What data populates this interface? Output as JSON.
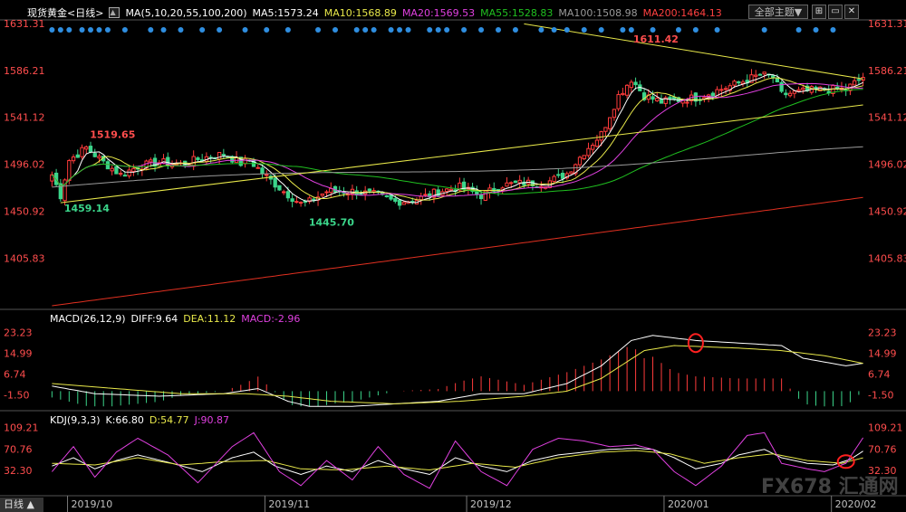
{
  "header": {
    "title": "现货黄金<日线>",
    "ma_label": "MA(5,10,20,55,100,200)",
    "ma5": "MA5:1573.24",
    "ma10": "MA10:1568.89",
    "ma20": "MA20:1569.53",
    "ma55": "MA55:1528.83",
    "ma100": "MA100:1508.98",
    "ma200": "MA200:1464.13",
    "theme_button": "全部主题▼"
  },
  "macd_header": {
    "label": "MACD(26,12,9)",
    "diff": "DIFF:9.64",
    "dea": "DEA:11.12",
    "macd": "MACD:-2.96"
  },
  "kdj_header": {
    "label": "KDJ(9,3,3)",
    "k": "K:66.80",
    "d": "D:54.77",
    "j": "J:90.87"
  },
  "period_tab": "日线 ▲",
  "watermark": "FX678 汇通网",
  "colors": {
    "up": "#ff3b3b",
    "down": "#3bd58a",
    "ma5": "#ffffff",
    "ma10": "#e8e84a",
    "ma20": "#e040e0",
    "ma55": "#20c020",
    "ma100": "#9a9a9a",
    "ma200": "#e03020",
    "trend": "#e8e84a",
    "axis": "#c0c0c0"
  },
  "chart_data": [
    {
      "type": "candlestick",
      "title": "现货黄金<日线>",
      "price_ticks": [
        "1631.31",
        "1586.21",
        "1541.12",
        "1496.02",
        "1450.92",
        "1405.83"
      ],
      "ylim": [
        1360,
        1631.31
      ],
      "x_labels": [
        "2019/10",
        "2019/11",
        "2019/12",
        "2020/01",
        "2020/02"
      ],
      "annotations": [
        {
          "text": "1519.65",
          "value": 1519.65,
          "bar": 8
        },
        {
          "text": "1459.14",
          "value": 1459.14,
          "bar": 2
        },
        {
          "text": "1445.70",
          "value": 1445.7,
          "bar": 59
        },
        {
          "text": "1611.42",
          "value": 1611.42,
          "bar": 135
        }
      ],
      "anchors": [
        [
          0,
          1486
        ],
        [
          2,
          1466
        ],
        [
          4,
          1500
        ],
        [
          8,
          1512
        ],
        [
          12,
          1498
        ],
        [
          16,
          1486
        ],
        [
          20,
          1494
        ],
        [
          25,
          1498
        ],
        [
          30,
          1496
        ],
        [
          35,
          1502
        ],
        [
          40,
          1506
        ],
        [
          44,
          1497
        ],
        [
          46,
          1500
        ],
        [
          50,
          1484
        ],
        [
          54,
          1470
        ],
        [
          58,
          1458
        ],
        [
          60,
          1460
        ],
        [
          64,
          1470
        ],
        [
          70,
          1470
        ],
        [
          75,
          1467
        ],
        [
          80,
          1460
        ],
        [
          85,
          1462
        ],
        [
          90,
          1470
        ],
        [
          95,
          1474
        ],
        [
          100,
          1466
        ],
        [
          105,
          1476
        ],
        [
          110,
          1478
        ],
        [
          115,
          1478
        ],
        [
          120,
          1487
        ],
        [
          124,
          1508
        ],
        [
          128,
          1525
        ],
        [
          132,
          1562
        ],
        [
          135,
          1578
        ],
        [
          138,
          1562
        ],
        [
          142,
          1556
        ],
        [
          146,
          1558
        ],
        [
          150,
          1560
        ],
        [
          155,
          1567
        ],
        [
          160,
          1574
        ],
        [
          165,
          1582
        ],
        [
          168,
          1580
        ],
        [
          170,
          1563
        ],
        [
          175,
          1566
        ],
        [
          180,
          1568
        ],
        [
          185,
          1568
        ],
        [
          189,
          1580
        ]
      ],
      "ma_end_values": {
        "MA5": 1573.24,
        "MA10": 1568.89,
        "MA20": 1569.53,
        "MA55": 1528.83,
        "MA100": 1508.98,
        "MA200": 1464.13
      }
    },
    {
      "type": "bar",
      "title": "MACD(26,12,9)",
      "ticks": [
        "23.23",
        "14.99",
        "6.74",
        "-1.50"
      ],
      "ylim": [
        -7,
        28
      ],
      "diff_anchors": [
        [
          0,
          2
        ],
        [
          10,
          -1
        ],
        [
          25,
          -2
        ],
        [
          40,
          -1
        ],
        [
          48,
          1
        ],
        [
          55,
          -4
        ],
        [
          60,
          -6
        ],
        [
          70,
          -6
        ],
        [
          80,
          -5
        ],
        [
          90,
          -4
        ],
        [
          100,
          -1
        ],
        [
          110,
          -1
        ],
        [
          120,
          3
        ],
        [
          128,
          10
        ],
        [
          135,
          20
        ],
        [
          140,
          22
        ],
        [
          150,
          20
        ],
        [
          160,
          19
        ],
        [
          170,
          18
        ],
        [
          175,
          13
        ],
        [
          185,
          10
        ],
        [
          189,
          11
        ]
      ],
      "dea_anchors": [
        [
          0,
          3
        ],
        [
          15,
          1
        ],
        [
          30,
          -1
        ],
        [
          45,
          -1
        ],
        [
          55,
          -2
        ],
        [
          65,
          -4
        ],
        [
          80,
          -5
        ],
        [
          95,
          -4
        ],
        [
          110,
          -2
        ],
        [
          120,
          0
        ],
        [
          128,
          5
        ],
        [
          138,
          16
        ],
        [
          145,
          18
        ],
        [
          160,
          17
        ],
        [
          170,
          16
        ],
        [
          180,
          14
        ],
        [
          189,
          11
        ]
      ],
      "last": {
        "DIFF": 9.64,
        "DEA": 11.12,
        "MACD": -2.96
      }
    },
    {
      "type": "line",
      "title": "KDJ(9,3,3)",
      "ticks": [
        "109.21",
        "70.76",
        "32.30"
      ],
      "ylim": [
        -10,
        120
      ],
      "k_anchors": [
        [
          0,
          40
        ],
        [
          5,
          55
        ],
        [
          10,
          35
        ],
        [
          15,
          50
        ],
        [
          20,
          60
        ],
        [
          28,
          45
        ],
        [
          35,
          30
        ],
        [
          42,
          55
        ],
        [
          47,
          65
        ],
        [
          52,
          40
        ],
        [
          58,
          25
        ],
        [
          64,
          40
        ],
        [
          70,
          30
        ],
        [
          76,
          50
        ],
        [
          82,
          35
        ],
        [
          88,
          25
        ],
        [
          94,
          55
        ],
        [
          100,
          40
        ],
        [
          106,
          30
        ],
        [
          112,
          50
        ],
        [
          118,
          60
        ],
        [
          124,
          65
        ],
        [
          130,
          70
        ],
        [
          136,
          72
        ],
        [
          140,
          70
        ],
        [
          145,
          55
        ],
        [
          150,
          35
        ],
        [
          156,
          45
        ],
        [
          160,
          60
        ],
        [
          166,
          70
        ],
        [
          170,
          55
        ],
        [
          176,
          45
        ],
        [
          182,
          42
        ],
        [
          186,
          52
        ],
        [
          189,
          66.8
        ]
      ],
      "d_anchors": [
        [
          0,
          45
        ],
        [
          10,
          42
        ],
        [
          20,
          55
        ],
        [
          30,
          42
        ],
        [
          40,
          48
        ],
        [
          50,
          50
        ],
        [
          58,
          35
        ],
        [
          68,
          33
        ],
        [
          78,
          40
        ],
        [
          88,
          33
        ],
        [
          98,
          45
        ],
        [
          108,
          38
        ],
        [
          118,
          55
        ],
        [
          128,
          65
        ],
        [
          136,
          68
        ],
        [
          144,
          62
        ],
        [
          152,
          45
        ],
        [
          160,
          55
        ],
        [
          168,
          62
        ],
        [
          176,
          50
        ],
        [
          184,
          45
        ],
        [
          189,
          54.77
        ]
      ],
      "j_anchors": [
        [
          0,
          30
        ],
        [
          5,
          75
        ],
        [
          10,
          20
        ],
        [
          15,
          65
        ],
        [
          20,
          90
        ],
        [
          27,
          60
        ],
        [
          34,
          10
        ],
        [
          42,
          75
        ],
        [
          47,
          100
        ],
        [
          53,
          30
        ],
        [
          58,
          5
        ],
        [
          64,
          50
        ],
        [
          70,
          15
        ],
        [
          76,
          75
        ],
        [
          82,
          25
        ],
        [
          88,
          0
        ],
        [
          94,
          85
        ],
        [
          100,
          30
        ],
        [
          106,
          5
        ],
        [
          112,
          70
        ],
        [
          118,
          90
        ],
        [
          124,
          85
        ],
        [
          130,
          75
        ],
        [
          136,
          78
        ],
        [
          140,
          70
        ],
        [
          145,
          30
        ],
        [
          150,
          5
        ],
        [
          156,
          40
        ],
        [
          162,
          95
        ],
        [
          166,
          100
        ],
        [
          170,
          45
        ],
        [
          176,
          35
        ],
        [
          180,
          30
        ],
        [
          185,
          45
        ],
        [
          189,
          90.87
        ]
      ],
      "last": {
        "K": 66.8,
        "D": 54.77,
        "J": 90.87
      }
    }
  ]
}
